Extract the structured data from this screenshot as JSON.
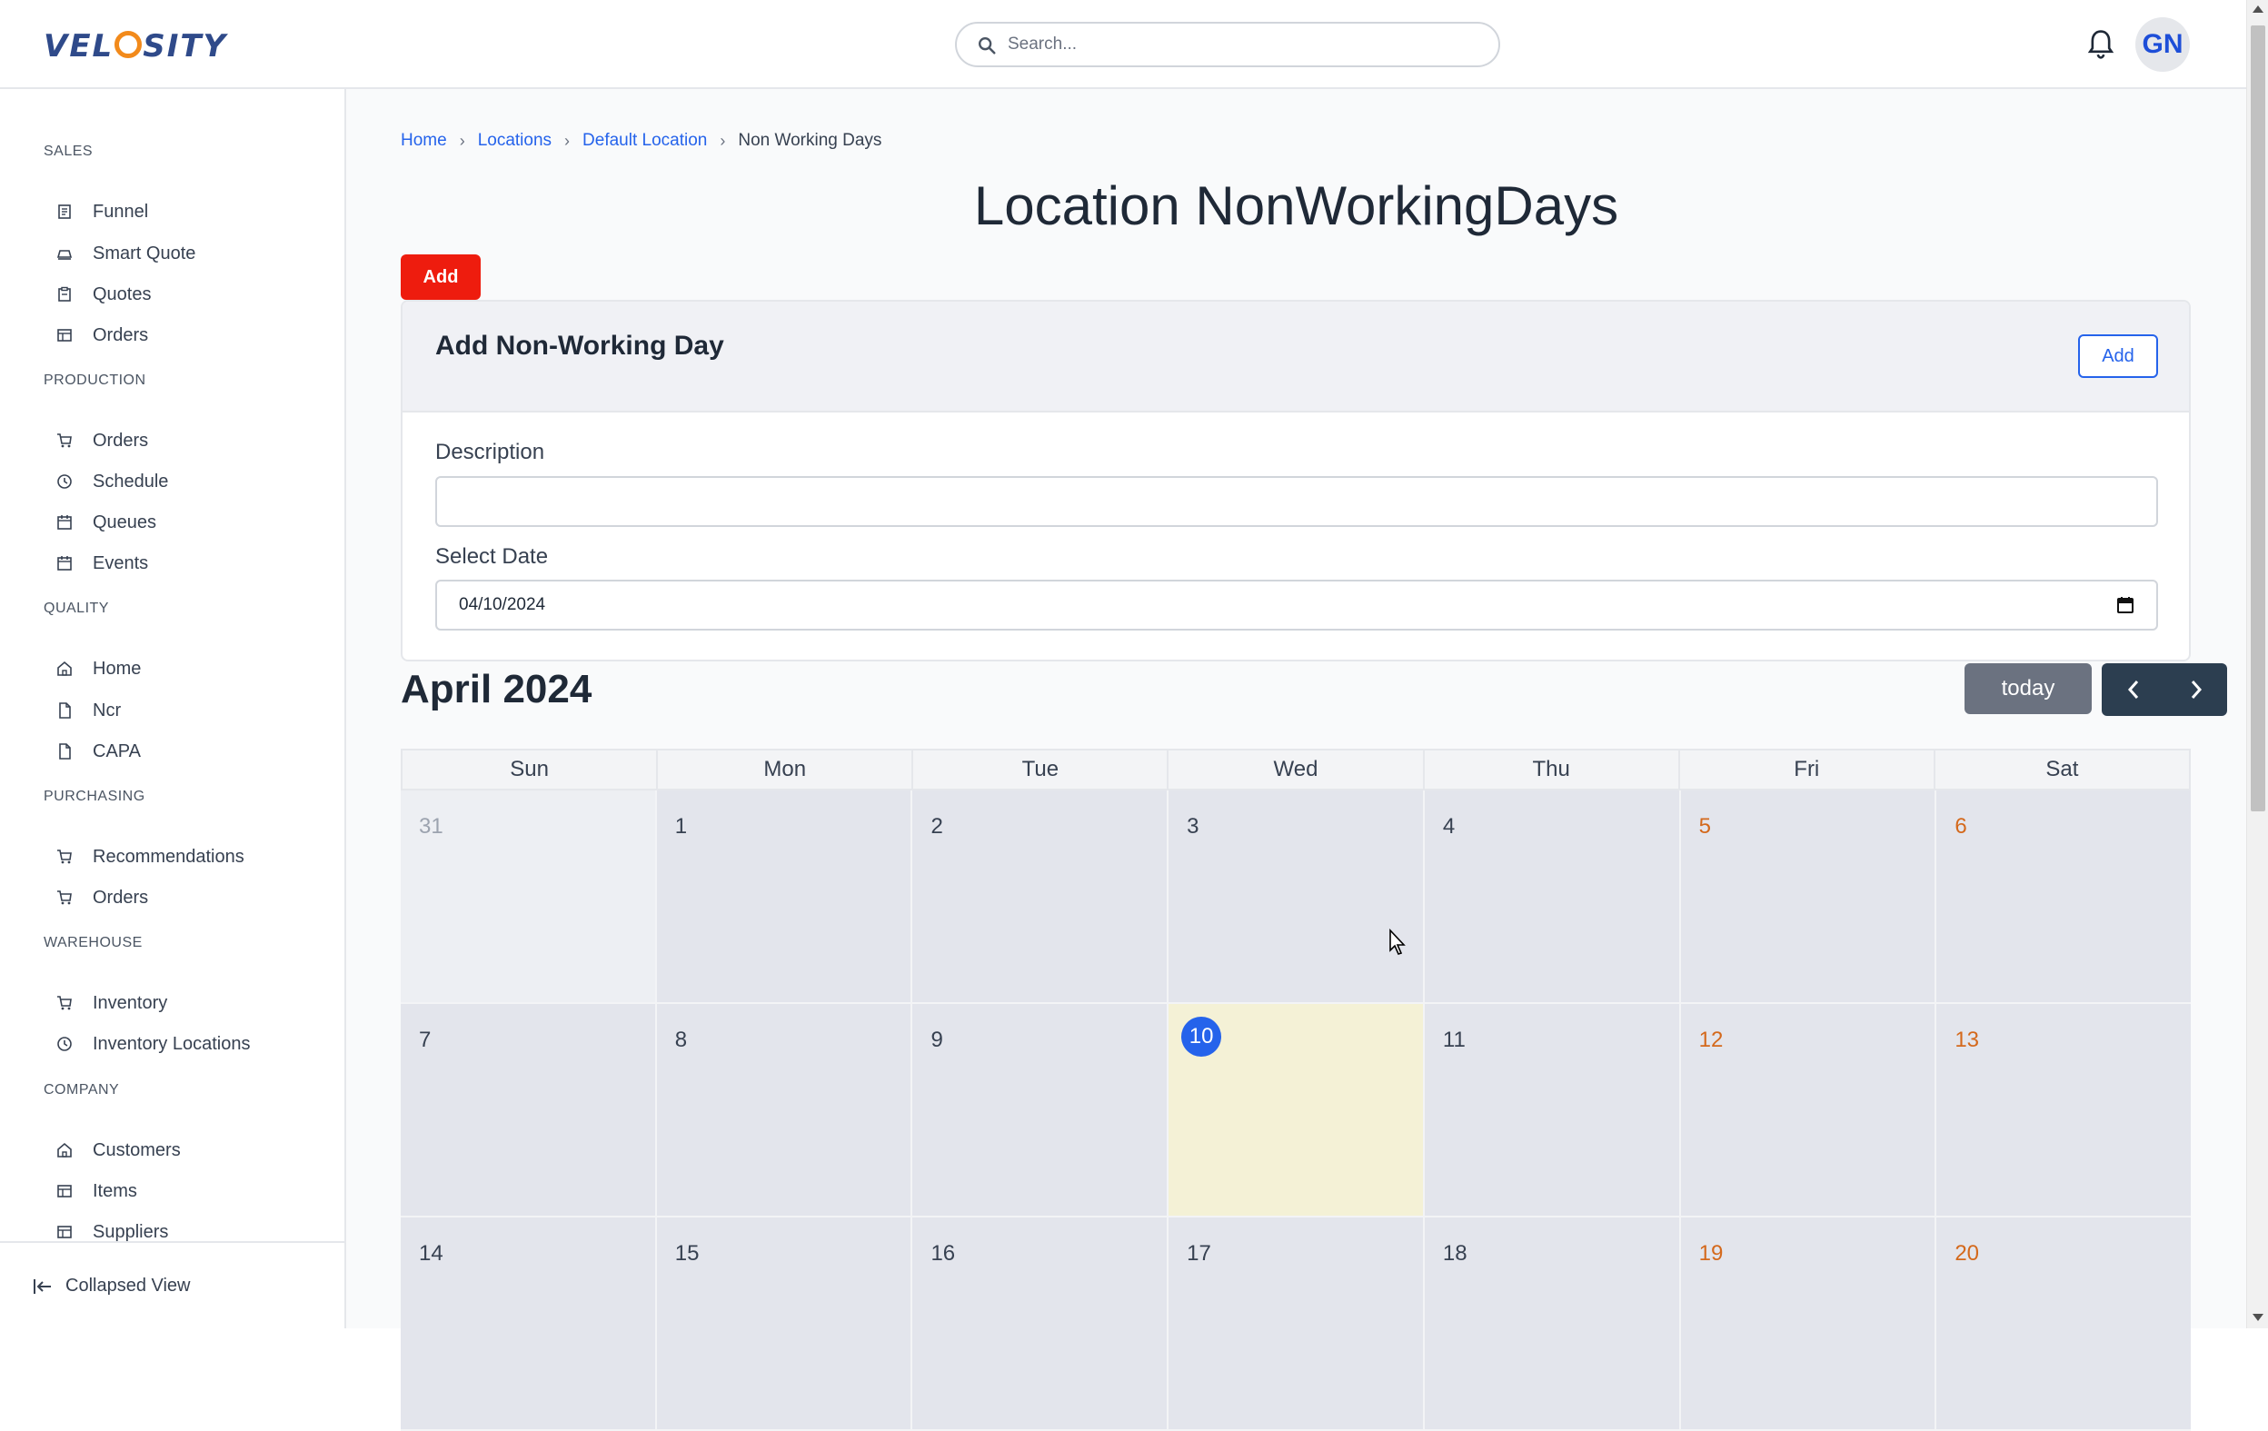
{
  "header": {
    "logo_text": "VELOSITY",
    "search_placeholder": "Search...",
    "avatar_initials": "GN"
  },
  "sidebar": {
    "sections": [
      {
        "title": "SALES",
        "items": [
          {
            "label": "Funnel",
            "icon": "funnel-icon"
          },
          {
            "label": "Smart Quote",
            "icon": "smart-quote-icon"
          },
          {
            "label": "Quotes",
            "icon": "quotes-icon"
          },
          {
            "label": "Orders",
            "icon": "orders-icon"
          }
        ]
      },
      {
        "title": "PRODUCTION",
        "items": [
          {
            "label": "Orders",
            "icon": "cart-icon"
          },
          {
            "label": "Schedule",
            "icon": "clock-icon"
          },
          {
            "label": "Queues",
            "icon": "calendar-icon"
          },
          {
            "label": "Events",
            "icon": "calendar-icon"
          }
        ]
      },
      {
        "title": "QUALITY",
        "items": [
          {
            "label": "Home",
            "icon": "home-icon"
          },
          {
            "label": "Ncr",
            "icon": "document-icon"
          },
          {
            "label": "CAPA",
            "icon": "document-icon"
          }
        ]
      },
      {
        "title": "PURCHASING",
        "items": [
          {
            "label": "Recommendations",
            "icon": "cart-icon"
          },
          {
            "label": "Orders",
            "icon": "cart-icon"
          }
        ]
      },
      {
        "title": "WAREHOUSE",
        "items": [
          {
            "label": "Inventory",
            "icon": "cart-icon"
          },
          {
            "label": "Inventory Locations",
            "icon": "clock-icon"
          }
        ]
      },
      {
        "title": "COMPANY",
        "items": [
          {
            "label": "Customers",
            "icon": "home-icon"
          },
          {
            "label": "Items",
            "icon": "items-icon"
          },
          {
            "label": "Suppliers",
            "icon": "items-icon"
          }
        ]
      }
    ],
    "collapse_label": "Collapsed View"
  },
  "breadcrumb": {
    "home": "Home",
    "locations": "Locations",
    "default_location": "Default Location",
    "current": "Non Working Days"
  },
  "page": {
    "title": "Location NonWorkingDays",
    "add_label": "Add"
  },
  "form": {
    "title": "Add Non-Working Day",
    "add_label": "Add",
    "description_label": "Description",
    "description_value": "",
    "date_label": "Select Date",
    "date_value": "04/10/2024"
  },
  "calendar": {
    "month_title": "April 2024",
    "today_label": "today",
    "weekdays": [
      "Sun",
      "Mon",
      "Tue",
      "Wed",
      "Thu",
      "Fri",
      "Sat"
    ],
    "weeks": [
      [
        "31",
        "1",
        "2",
        "3",
        "4",
        "5",
        "6"
      ],
      [
        "7",
        "8",
        "9",
        "10",
        "11",
        "12",
        "13"
      ],
      [
        "14",
        "15",
        "16",
        "17",
        "18",
        "19",
        "20"
      ]
    ],
    "today_day": "10",
    "weekend_color": "#d4691c",
    "today_highlight": "#f4f1d6"
  }
}
